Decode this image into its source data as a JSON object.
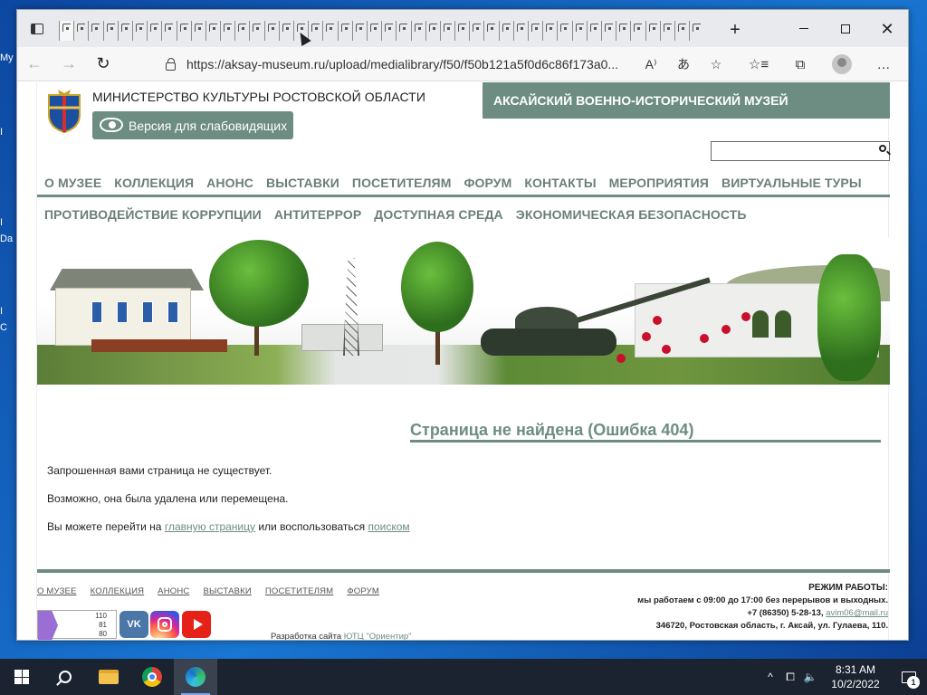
{
  "desktop": {
    "icons": [
      "My",
      "I",
      "I",
      "Da",
      "I",
      "C"
    ]
  },
  "browser": {
    "tab_count": 44,
    "new_tab_label": "+",
    "window": {
      "minimize": "minimize",
      "maximize": "maximize",
      "close": "✕"
    },
    "nav": {
      "back": "←",
      "forward": "→",
      "refresh": "↻"
    },
    "url": "https://aksay-museum.ru/upload/medialibrary/f50/f50b121a5f0d6c86f173a0...",
    "address_icons": [
      "read-aloud-icon",
      "translate-icon",
      "add-favorite-icon"
    ],
    "address_icon_glyphs": [
      "A⁾",
      "あ",
      "☆"
    ],
    "tools": [
      "favorites-icon",
      "collections-icon",
      "profile-avatar",
      "more-icon"
    ],
    "tool_glyphs": [
      "☆≡",
      "⧉",
      "",
      "…"
    ]
  },
  "site": {
    "ministry": "МИНИСТЕРСТВО КУЛЬТУРЫ РОСТОВСКОЙ ОБЛАСТИ",
    "accessibility_button": "Версия для слабовидящих",
    "museum_name": "АКСАЙСКИЙ ВОЕННО-ИСТОРИЧЕСКИЙ МУЗЕЙ",
    "search_placeholder": "",
    "menu_row1": [
      "О МУЗЕЕ",
      "КОЛЛЕКЦИЯ",
      "АНОНС",
      "ВЫСТАВКИ",
      "ПОСЕТИТЕЛЯМ",
      "ФОРУМ",
      "КОНТАКТЫ",
      "МЕРОПРИЯТИЯ",
      "ВИРТУАЛЬНЫЕ ТУРЫ"
    ],
    "menu_row2": [
      "ПРОТИВОДЕЙСТВИЕ КОРРУПЦИИ",
      "АНТИТЕРРОР",
      "ДОСТУПНАЯ СРЕДА",
      "ЭКОНОМИЧЕСКАЯ БЕЗОПАСНОСТЬ"
    ],
    "error_title": "Страница не найдена (Ошибка 404)",
    "msg1": "Запрошенная вами страница не существует.",
    "msg2": "Возможно, она была удалена или перемещена.",
    "msg3_prefix": "Вы можете перейти на",
    "msg3_link1": "главную страницу",
    "msg3_middle": "или воспользоваться",
    "msg3_link2": "поиском",
    "footer_nav": [
      "О МУЗЕЕ",
      "КОЛЛЕКЦИЯ",
      "АНОНС",
      "ВЫСТАВКИ",
      "ПОСЕТИТЕЛЯМ",
      "ФОРУМ"
    ],
    "counter": {
      "values": [
        "110",
        "81",
        "80"
      ]
    },
    "social": {
      "vk": "vk",
      "youtube": "youtube",
      "instagram": "instagram"
    },
    "developer_prefix": "Разработка сайта",
    "developer_link": "ЮТЦ \"Ориентир\"",
    "hours_label": "РЕЖИМ РАБОТЫ:",
    "hours": "мы работаем с 09:00 до 17:00 без перерывов и выходных.",
    "phone": "+7 (86350) 5-28-13,",
    "email": "avim06@mail.ru",
    "address": "346720, Ростовская область, г. Аксай, ул. Гулаева, 110."
  },
  "taskbar": {
    "clock_time": "8:31 AM",
    "clock_date": "10/2/2022",
    "notifications": "1",
    "tray_icons": [
      "^",
      "⧠",
      "🔈"
    ]
  }
}
